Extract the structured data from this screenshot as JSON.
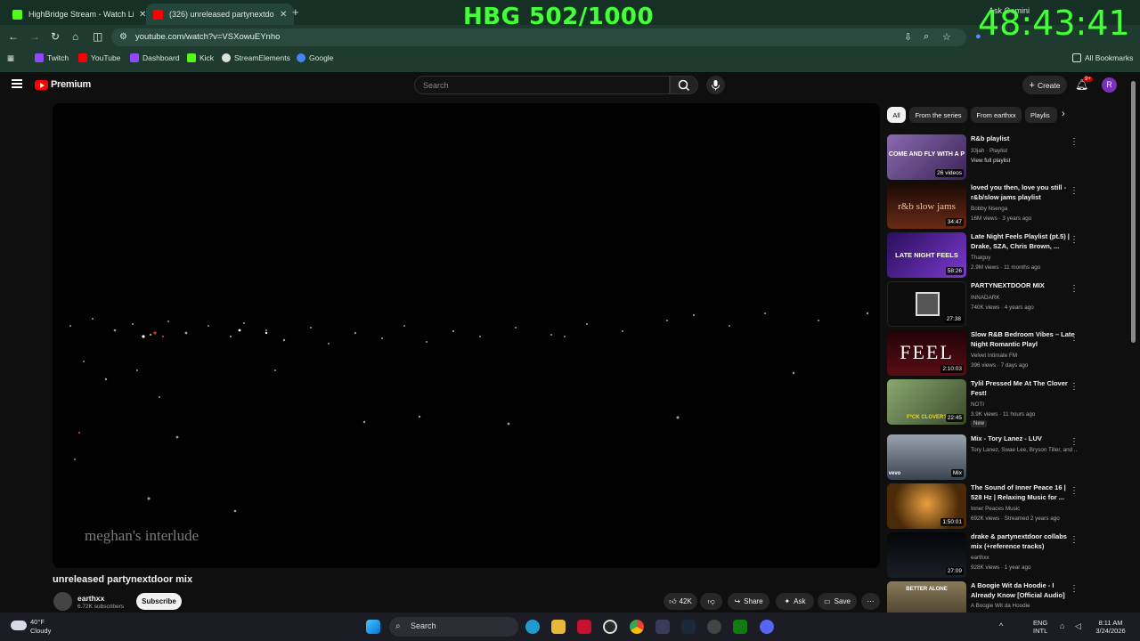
{
  "browser": {
    "tabs": [
      {
        "title": "HighBridge Stream - Watch Liv",
        "active": false
      },
      {
        "title": "(326) unreleased partynextdoor",
        "active": true
      }
    ],
    "url": "youtube.com/watch?v=VSXowuEYnho",
    "gemini": "Ask Gemini",
    "bookmarks": [
      "Twitch",
      "YouTube",
      "Dashboard",
      "Kick",
      "StreamElements",
      "Google"
    ],
    "all_bookmarks": "All Bookmarks"
  },
  "overlay": {
    "title": "HBG 502/1000",
    "timer": "48:43:41"
  },
  "youtube": {
    "logo": "Premium",
    "search_placeholder": "Search",
    "create": "Create",
    "notif_badge": "9+",
    "avatar_letter": "R",
    "player_caption": "meghan's interlude",
    "video_title": "unreleased partynextdoor mix",
    "channel": "earthxx",
    "subscribers": "6.72K subscribers",
    "subscribe": "Subscribe",
    "likes": "42K",
    "share": "Share",
    "ask": "Ask",
    "save": "Save",
    "chips": [
      "All",
      "From the series",
      "From earthxx",
      "Playlis"
    ],
    "recs": [
      {
        "title": "R&b playlist",
        "channel": "33jah · Playlist",
        "meta": "View full playlist",
        "dur": "26 videos",
        "thumb_text": "COME AND FLY WITH A P",
        "bg": "#6a4b8a"
      },
      {
        "title": "loved you then, love you still - r&b/slow jams playlist",
        "channel": "Bobby Nsenga",
        "meta": "16M views · 3 years ago",
        "dur": "34:47",
        "thumb_text": "r&b slow jams",
        "bg": "#5a2418"
      },
      {
        "title": "Late Night Feels Playlist (pt.5) | Drake, SZA, Chris Brown, ...",
        "channel": "Thaiguy",
        "meta": "2.9M views · 11 months ago",
        "dur": "58:26",
        "thumb_text": "LATE NIGHT FEELS",
        "bg": "#4a1e8a"
      },
      {
        "title": "PARTYNEXTDOOR MIX",
        "channel": "INNADARK",
        "meta": "740K views · 4 years ago",
        "dur": "27:38",
        "thumb_text": "",
        "bg": "#0d0d0d"
      },
      {
        "title": "Slow R&B Bedroom Vibes – Late Night Romantic Playl",
        "channel": "Velvet Intimate FM",
        "meta": "396 views · 7 days ago",
        "dur": "2:10:03",
        "thumb_text": "FEEL",
        "bg": "#3a0a0e"
      },
      {
        "title": "Tylil Pressed Me At The Clover Fest!",
        "channel": "NOTI",
        "meta": "3.9K views · 11 hours ago",
        "dur": "22:45",
        "thumb_text": "F*CK CLOVER?",
        "bg": "#5b7a4a",
        "new": "New"
      },
      {
        "title": "Mix - Tory Lanez - LUV",
        "channel": "Tory Lanez, Swae Lee, Bryson Tiller, and ...",
        "meta": "",
        "dur": "Mix",
        "thumb_text": "vevo",
        "bg": "#5e6a78"
      },
      {
        "title": "The Sound of Inner Peace 16 | 528 Hz | Relaxing Music for ...",
        "channel": "Inner Peaces Music",
        "meta": "692K views · Streamed 2 years ago",
        "dur": "1:50:01",
        "thumb_text": "",
        "bg": "#6a4a14"
      },
      {
        "title": "drake & partynextdoor collabs mix (+reference tracks)",
        "channel": "earthxx",
        "meta": "928K views · 1 year ago",
        "dur": "27:09",
        "thumb_text": "",
        "bg": "#111418"
      },
      {
        "title": "A Boogie Wit da Hoodie - I Already Know [Official Audio]",
        "channel": "A Boogie Wit da Hoodie",
        "meta": "",
        "dur": "",
        "thumb_text": "BETTER ALONE",
        "bg": "#6a5a40"
      }
    ]
  },
  "taskbar": {
    "temp": "40°F",
    "weather": "Cloudy",
    "search": "Search",
    "lang1": "ENG",
    "lang2": "INTL",
    "time": "8:11 AM",
    "date": "3/24/2026"
  }
}
